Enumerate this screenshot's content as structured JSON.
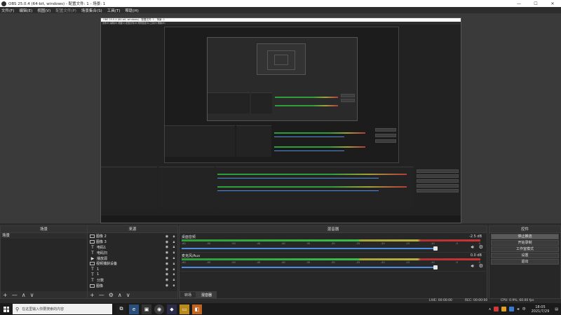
{
  "window": {
    "title": "OBS 25.0.4 (64-bit, windows) - 配置文件: 1 - 场景: 1",
    "controls": [
      "—",
      "☐",
      "✕"
    ]
  },
  "menu": {
    "items": [
      "文件(F)",
      "编辑(E)",
      "视图(V)",
      "配置文件(P)",
      "场景集合(S)",
      "工具(T)",
      "帮助(H)"
    ]
  },
  "preview": {
    "inner_title": "OBS 25.0.4 (64-bit, windows) - 配置文件: 1 - 场景: 1",
    "inner_menu": "文件(F)  编辑(E)  视图(V)  配置文件(P)  场景集合(S)  工具(T)  帮助(H)"
  },
  "scenes": {
    "title": "场景",
    "items": [
      "场景"
    ],
    "footer": [
      "+",
      "—",
      "∧",
      "∨"
    ]
  },
  "sources": {
    "title": "来源",
    "items": [
      {
        "icon": "image-icon",
        "name": "图像 2"
      },
      {
        "icon": "image-icon",
        "name": "图像 3"
      },
      {
        "icon": "text-icon",
        "name": "电码1"
      },
      {
        "icon": "text-icon",
        "name": "电码扫"
      },
      {
        "icon": "play-icon",
        "name": "播放源"
      },
      {
        "icon": "image-icon",
        "name": "视频捕获设备"
      },
      {
        "icon": "text-icon",
        "name": "1"
      },
      {
        "icon": "text-icon",
        "name": "1"
      },
      {
        "icon": "text-icon",
        "name": "分数"
      },
      {
        "icon": "image-icon",
        "name": "图像"
      },
      {
        "icon": "text-icon",
        "name": "文本"
      }
    ],
    "footer": [
      "+",
      "—",
      "⚙",
      "∧",
      "∨"
    ]
  },
  "mixer": {
    "title": "混音器",
    "channels": [
      {
        "name": "桌面音频",
        "db": "-2.5 dB",
        "level": 0.88,
        "volume": 0.92
      },
      {
        "name": "麦克风/Aux",
        "db": "0.0 dB",
        "level": 0.81,
        "volume": 0.92
      }
    ],
    "scale": [
      "-60",
      "-55",
      "-50",
      "-45",
      "-40",
      "-35",
      "-30",
      "-25",
      "-20",
      "-15",
      "-10",
      "-5",
      "0"
    ],
    "tabs": [
      "转场",
      "混音器"
    ],
    "active_tab": "混音器"
  },
  "controls": {
    "title": "控件",
    "buttons": [
      "停止推流",
      "开始录制",
      "工作室模式",
      "设置",
      "退出"
    ],
    "active": "停止推流"
  },
  "status": {
    "live": "LIVE: 00:00:00",
    "rec": "REC: 00:00:00",
    "cpu": "CPU: 0.9%, 60.00 fps"
  },
  "taskbar": {
    "search_placeholder": "在这里输入你要搜索的内容",
    "time": "18:05",
    "date": "2021/7/29",
    "lang": "中"
  },
  "colors": {
    "accent_blue": "#4d8de0",
    "meter_green": "#3bbd46",
    "meter_yellow": "#b9b13e",
    "meter_red": "#c33333"
  }
}
